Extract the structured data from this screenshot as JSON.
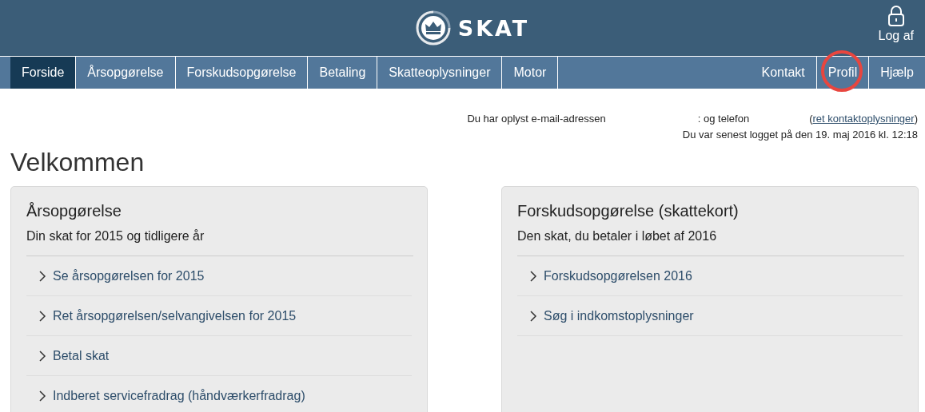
{
  "header": {
    "logo": "SKAT",
    "logout": "Log af"
  },
  "nav_left": [
    {
      "label": "Forside",
      "selected": true
    },
    {
      "label": "Årsopgørelse",
      "selected": false
    },
    {
      "label": "Forskudsopgørelse",
      "selected": false
    },
    {
      "label": "Betaling",
      "selected": false
    },
    {
      "label": "Skatteoplysninger",
      "selected": false
    },
    {
      "label": "Motor",
      "selected": false
    }
  ],
  "nav_right": [
    {
      "label": "Kontakt",
      "selected": false,
      "circled": false
    },
    {
      "label": "Profil",
      "selected": false,
      "circled": true
    },
    {
      "label": "Hjælp",
      "selected": false,
      "circled": false
    }
  ],
  "contact_info": {
    "email_text": "Du har oplyst e-mail-adressen",
    "phone_text": ": og telefon",
    "link_open": "(",
    "link": "ret kontaktoplysninger",
    "link_close": ")",
    "last_login": "Du var senest logget på den 19. maj 2016 kl. 12:18"
  },
  "heading": "Velkommen",
  "cards": [
    {
      "title": "Årsopgørelse",
      "subtitle": "Din skat for 2015 og tidligere år",
      "links": [
        "Se årsopgørelsen for 2015",
        "Ret årsopgørelsen/selvangivelsen for 2015",
        "Betal skat",
        "Indberet servicefradrag (håndværkerfradrag)"
      ]
    },
    {
      "title": "Forskudsopgørelse (skattekort)",
      "subtitle": "Den skat, du betaler i løbet af 2016",
      "links": [
        "Forskudsopgørelsen 2016",
        "Søg i indkomstoplysninger"
      ]
    }
  ]
}
